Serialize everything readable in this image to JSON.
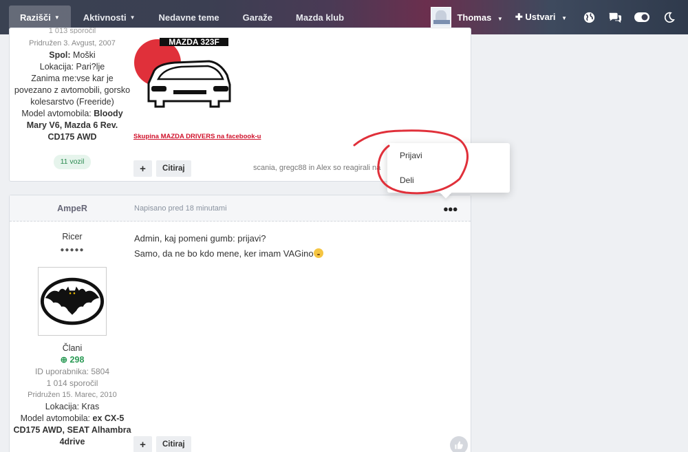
{
  "navbar": {
    "items": [
      {
        "label": "Razišči"
      },
      {
        "label": "Aktivnosti"
      },
      {
        "label": "Nedavne teme"
      },
      {
        "label": "Garaže"
      },
      {
        "label": "Mazda klub"
      }
    ],
    "user_name": "Thomas",
    "create_label": "Ustvari"
  },
  "post1": {
    "author": {
      "posts_clipped": "1 013 sporočil",
      "joined": "Pridružen 3. Avgust, 2007",
      "gender_label": "Spol:",
      "gender_value": "Moški",
      "location": "Lokacija: Pari?lje",
      "interests": "Zanima me:vse kar je povezano z avtomobili, gorsko kolesarstvo (Freeride)",
      "car_label": "Model avtomobila:",
      "car_value": "Bloody Mary V6, Mazda 6 Rev. CD175 AWD",
      "vehicles": "11 vozil"
    },
    "signature_logo_text": "MAZDA 323F",
    "facebook_link": "Skupina MAZDA DRIVERS na facebook-u",
    "cite_label": "Citiraj",
    "reactions_text": "scania, gregc88 in Alex so reagirali na"
  },
  "post2": {
    "author_name": "AmpeR",
    "posted_at": "Napisano pred 18 minutami",
    "author": {
      "rank": "Ricer",
      "rank_dots": "●●●●●",
      "group": "Člani",
      "reputation": "298",
      "user_id": "ID uporabnika: 5804",
      "posts": "1 014 sporočil",
      "joined": "Pridružen 15. Marec, 2010",
      "location": "Lokacija: Kras",
      "car_label": "Model avtomobila:",
      "car_value": "ex CX-5 CD175 AWD, SEAT Alhambra 4drive"
    },
    "body_line1": "Admin, kaj pomeni gumb: prijavi?",
    "body_line2": "Samo, da ne bo kdo mene, ker imam VAGino",
    "cite_label": "Citiraj"
  },
  "dropdown": {
    "items": [
      {
        "label": "Prijavi"
      },
      {
        "label": "Deli"
      }
    ]
  },
  "colors": {
    "accent_red": "#e0303a",
    "link_red": "#d0112b",
    "reputation_green": "#2a9a55"
  },
  "icons": [
    "chevron-down-icon",
    "plus-icon",
    "globe-icon",
    "chat-icon",
    "toggle-icon",
    "moon-icon",
    "ellipsis-icon",
    "thumbs-up-icon",
    "bat-logo-icon"
  ]
}
